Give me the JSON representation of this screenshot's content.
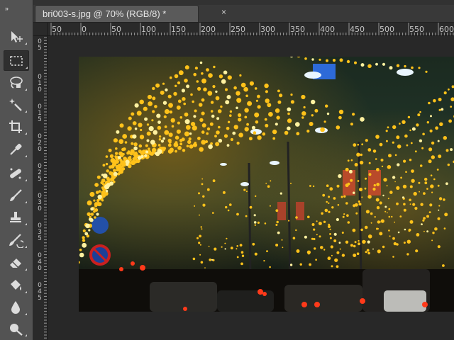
{
  "document": {
    "tab_title": "bri003-s.jpg @ 70% (RGB/8) *",
    "close_symbol": "×"
  },
  "toolbar": {
    "collapse_symbol": "»",
    "tools": [
      {
        "name": "move-tool",
        "icon": "move-icon"
      },
      {
        "name": "rectangular-marquee-tool",
        "icon": "marquee-icon",
        "selected": true
      },
      {
        "name": "lasso-tool",
        "icon": "lasso-icon"
      },
      {
        "name": "magic-wand-tool",
        "icon": "magic-wand-icon"
      },
      {
        "name": "crop-tool",
        "icon": "crop-icon"
      },
      {
        "name": "eyedropper-tool",
        "icon": "eyedropper-icon"
      },
      {
        "name": "spot-healing-tool",
        "icon": "healing-icon"
      },
      {
        "name": "brush-tool",
        "icon": "brush-icon"
      },
      {
        "name": "clone-stamp-tool",
        "icon": "stamp-icon"
      },
      {
        "name": "history-brush-tool",
        "icon": "history-brush-icon"
      },
      {
        "name": "eraser-tool",
        "icon": "eraser-icon"
      },
      {
        "name": "paint-bucket-tool",
        "icon": "paint-bucket-icon"
      },
      {
        "name": "blur-tool",
        "icon": "blur-icon"
      },
      {
        "name": "dodge-tool",
        "icon": "dodge-icon"
      }
    ]
  },
  "rulers": {
    "horizontal": [
      "50",
      "0",
      "50",
      "100",
      "150",
      "200",
      "250",
      "300",
      "350",
      "400",
      "450",
      "500",
      "550",
      "600"
    ],
    "vertical": [
      "0",
      "5",
      "0",
      "1",
      "0",
      "0",
      "1",
      "5",
      "0",
      "2",
      "0",
      "0",
      "2",
      "5",
      "0",
      "3",
      "0",
      "0",
      "3",
      "5",
      "0",
      "4",
      "0",
      "0",
      "4",
      "5"
    ]
  },
  "colors": {
    "workspace": "#282828",
    "toolbar": "#535353",
    "ruler": "#2a2a2a",
    "light_gold": "#ffc21a"
  }
}
